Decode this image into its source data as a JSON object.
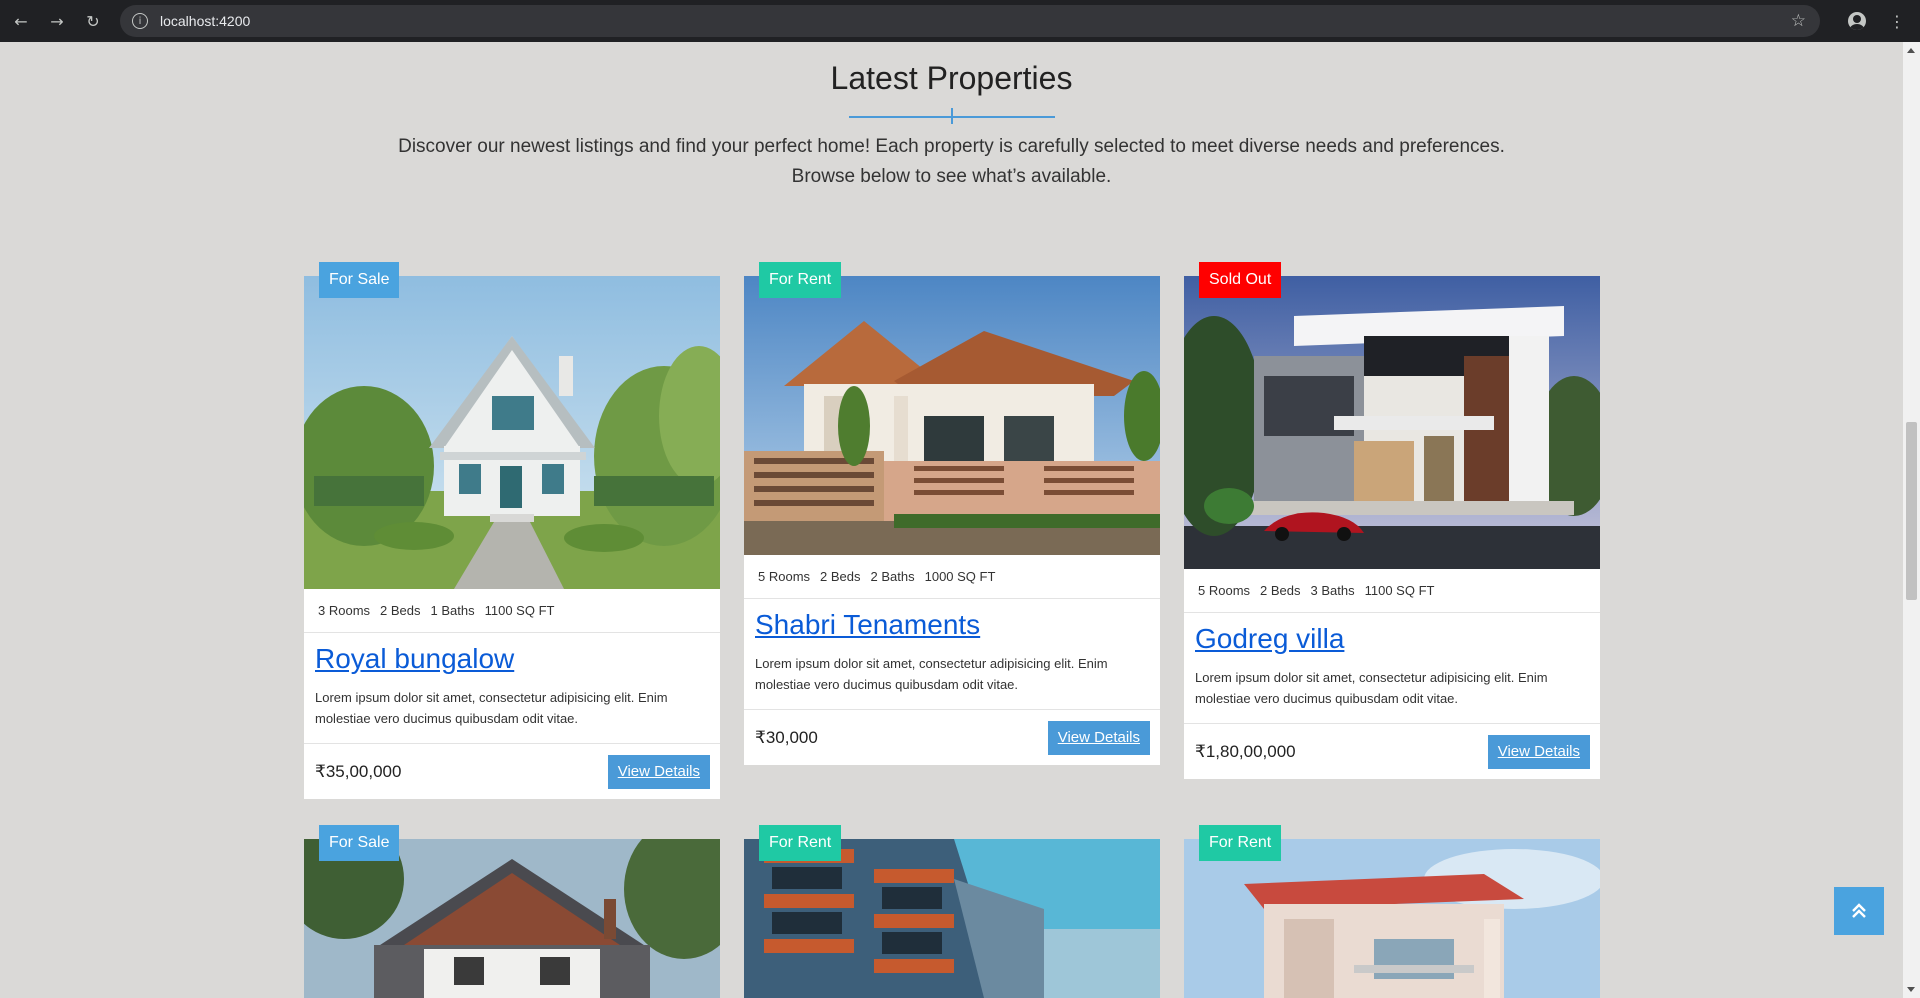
{
  "browser": {
    "url": "localhost:4200",
    "icons": [
      "back-arrow",
      "forward-arrow",
      "reload",
      "site-info",
      "bookmark-star",
      "profile",
      "more-menu"
    ]
  },
  "section": {
    "title": "Latest Properties",
    "description_line1": "Discover our newest listings and find your perfect home! Each property is carefully selected to meet diverse needs and preferences.",
    "description_line2": "Browse below to see what’s available."
  },
  "colors": {
    "accent": "#4a9ad8",
    "for_sale": "#4aa3df",
    "for_rent": "#1fc9a4",
    "sold_out": "#ff0000",
    "link": "#0a5bd7",
    "background": "#dad9d7"
  },
  "properties": [
    {
      "badge": "For Sale",
      "rooms": "3 Rooms",
      "beds": "2 Beds",
      "baths": "1 Baths",
      "area": "1100 SQ FT",
      "title": "Royal bungalow",
      "description": "Lorem ipsum dolor sit amet, consectetur adipisicing elit. Enim molestiae vero ducimus quibusdam odit vitae.",
      "price": "₹35,00,000",
      "button": "View Details"
    },
    {
      "badge": "For Rent",
      "rooms": "5 Rooms",
      "beds": "2 Beds",
      "baths": "2 Baths",
      "area": "1000 SQ FT",
      "title": "Shabri Tenaments",
      "description": "Lorem ipsum dolor sit amet, consectetur adipisicing elit. Enim molestiae vero ducimus quibusdam odit vitae.",
      "price": "₹30,000",
      "button": "View Details"
    },
    {
      "badge": "Sold Out",
      "rooms": "5 Rooms",
      "beds": "2 Beds",
      "baths": "3 Baths",
      "area": "1100 SQ FT",
      "title": "Godreg villa",
      "description": "Lorem ipsum dolor sit amet, consectetur adipisicing elit. Enim molestiae vero ducimus quibusdam odit vitae.",
      "price": "₹1,80,00,000",
      "button": "View Details"
    },
    {
      "badge": "For Sale"
    },
    {
      "badge": "For Rent"
    },
    {
      "badge": "For Rent"
    }
  ],
  "back_to_top": "chevron-double-up-icon"
}
